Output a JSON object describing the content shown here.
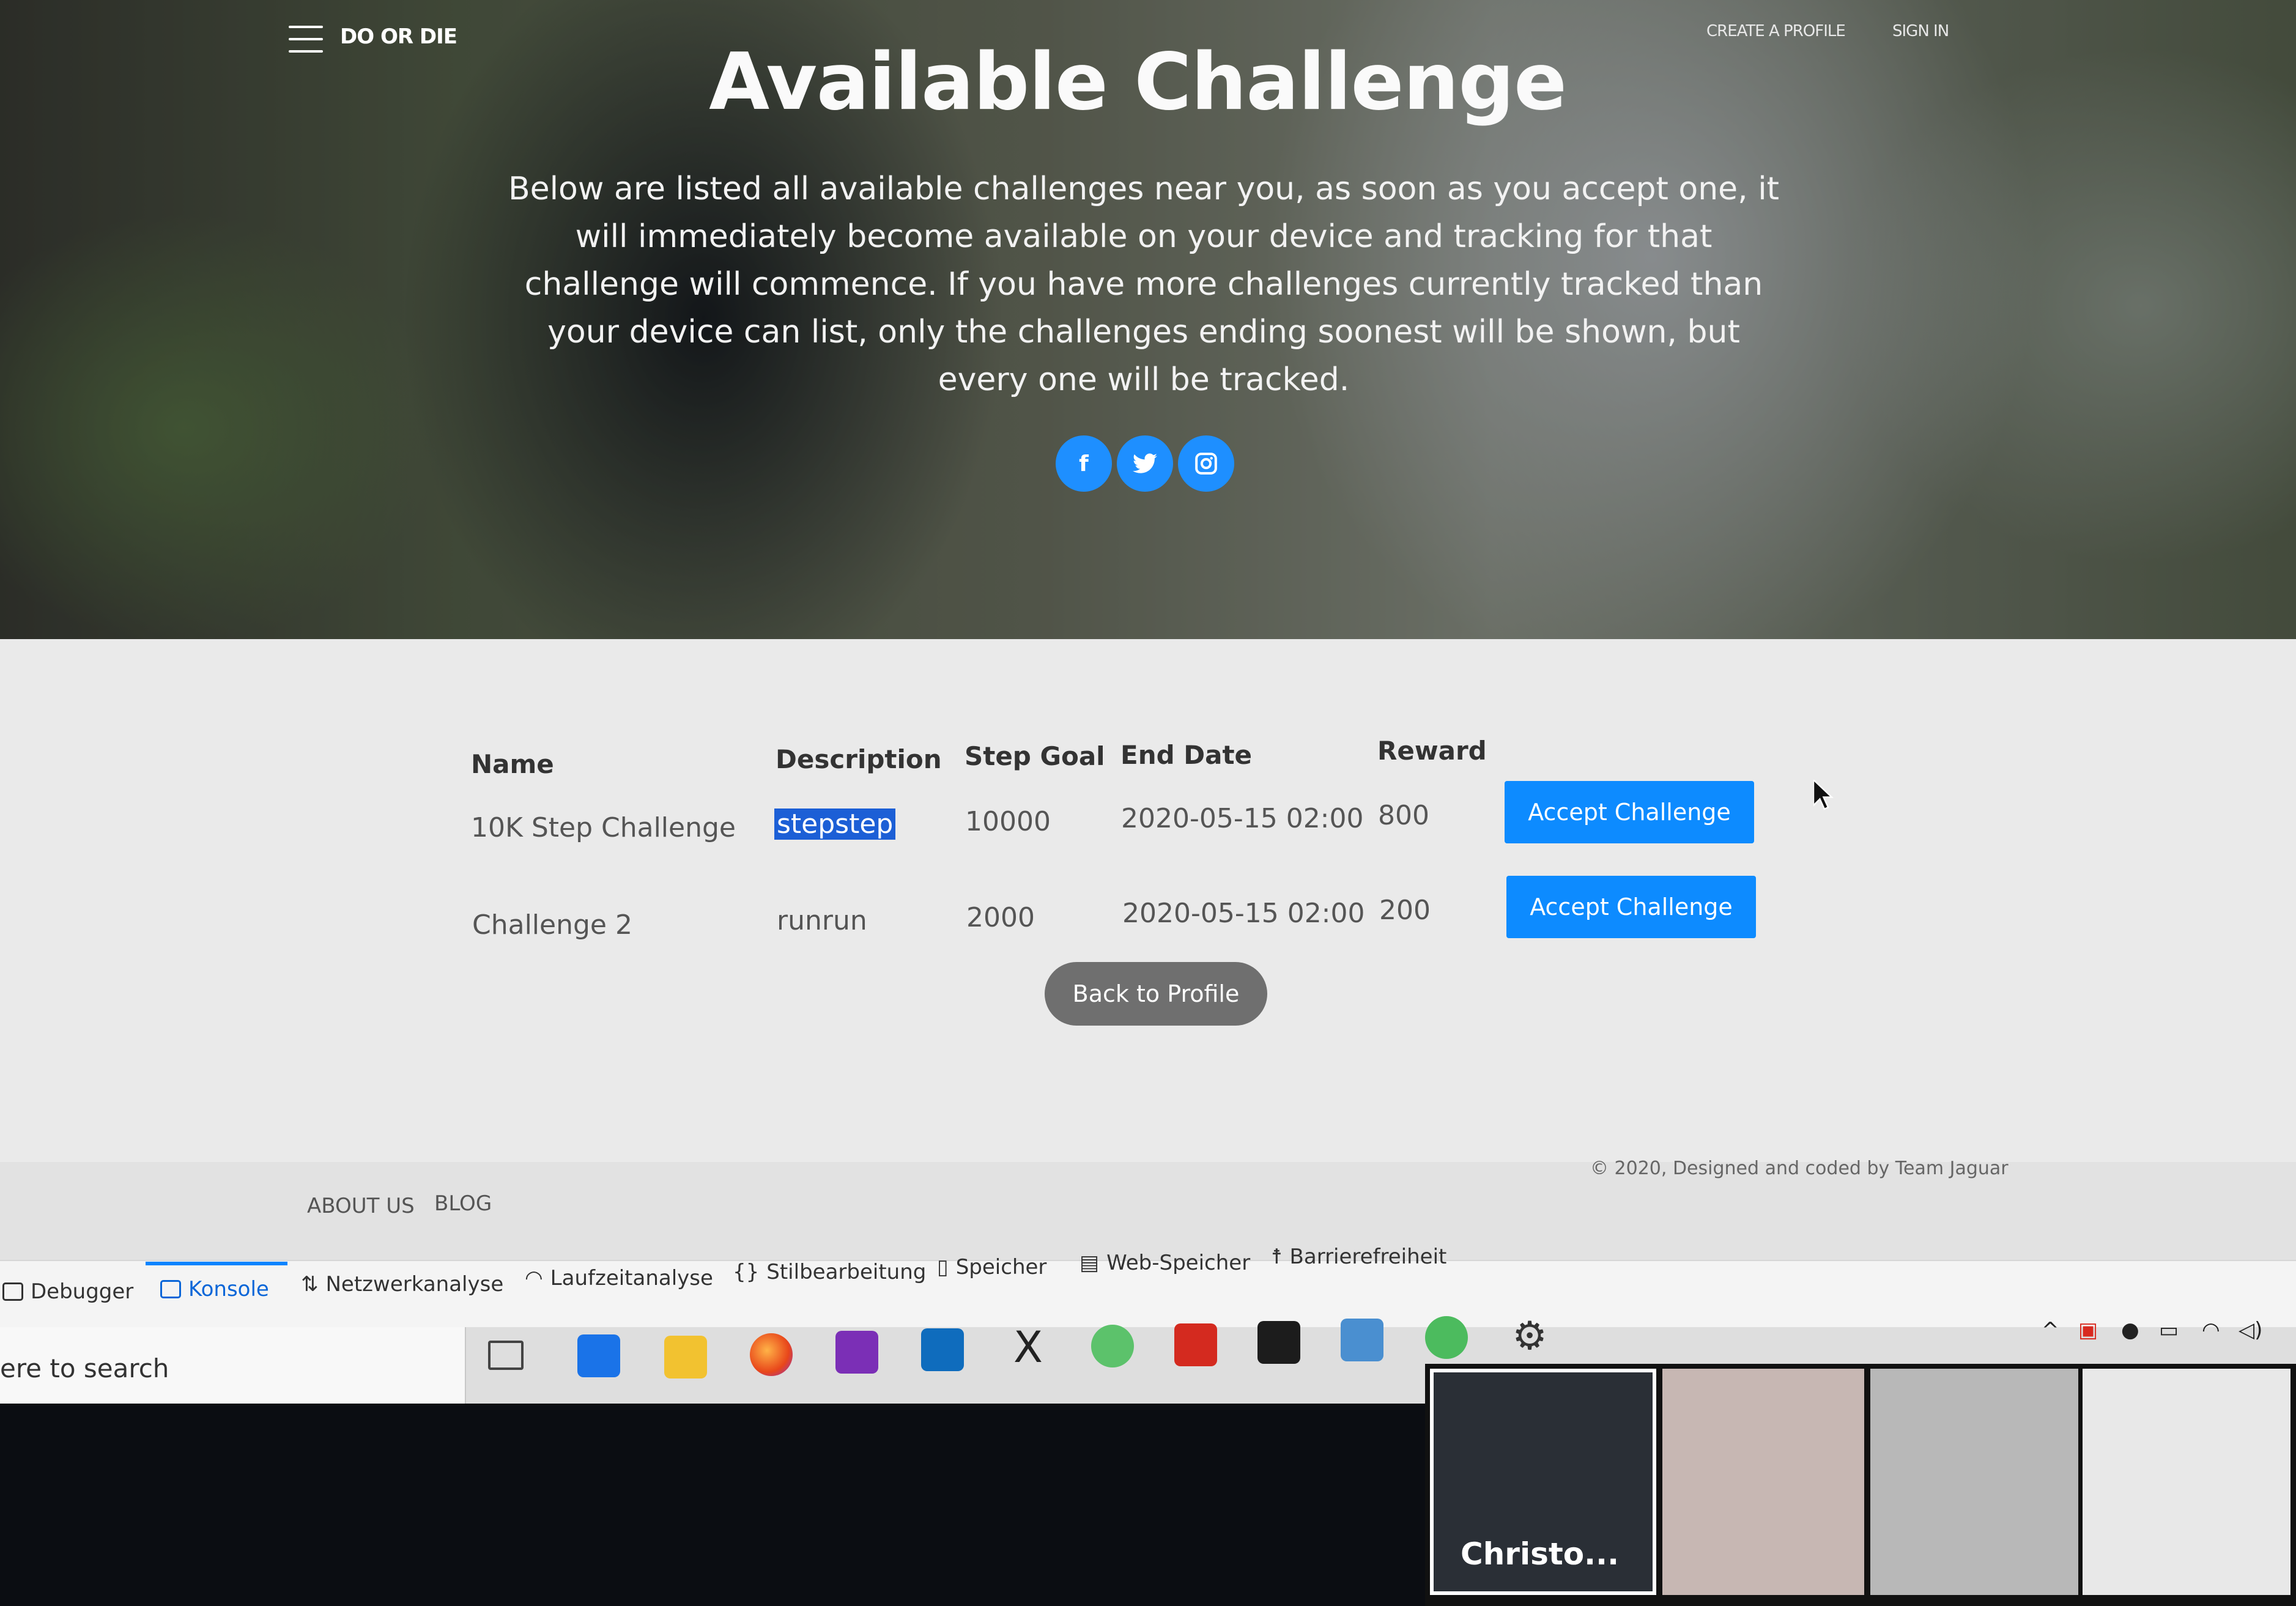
{
  "header": {
    "brand": "DO OR DIE",
    "create_profile": "CREATE A PROFILE",
    "sign_in": "SIGN IN"
  },
  "hero": {
    "title": "Available Challenge",
    "description": "Below are listed all available challenges near you, as soon as you accept one, it will immediately become available on your device and tracking for that challenge will commence. If you have more challenges currently tracked than your device can list, only the challenges ending soonest will be shown, but every one will be tracked."
  },
  "table": {
    "headers": [
      "Name",
      "Description",
      "Step Goal",
      "End Date",
      "Reward"
    ],
    "rows": [
      {
        "name": "10K Step Challenge",
        "description": "stepstep",
        "step_goal": "10000",
        "end_date": "2020-05-15 02:00",
        "reward": "800",
        "action": "Accept Challenge"
      },
      {
        "name": "Challenge 2",
        "description": "runrun",
        "step_goal": "2000",
        "end_date": "2020-05-15 02:00",
        "reward": "200",
        "action": "Accept Challenge"
      }
    ]
  },
  "back_button": "Back to Profile",
  "footer": {
    "about": "ABOUT US",
    "blog": "BLOG",
    "copyright": "© 2020, Designed and coded by Team Jaguar"
  },
  "devtools": {
    "tabs": [
      "Debugger",
      "Konsole",
      "Netzwerkanalyse",
      "Laufzeitanalyse",
      "Stilbearbeitung",
      "Speicher",
      "Web-Speicher",
      "Barrierefreiheit"
    ],
    "active_tab": "Konsole"
  },
  "taskbar": {
    "search_placeholder": "ere to search",
    "apps": [
      "task-view",
      "app-blue",
      "file-explorer",
      "firefox",
      "onenote",
      "outlook",
      "x-app",
      "atom",
      "acrobat",
      "terminal",
      "network",
      "atom-2",
      "settings"
    ]
  },
  "video_call": {
    "participant_name": "Christo..."
  },
  "colors": {
    "accent": "#0d8bff",
    "social": "#1e8fff"
  }
}
